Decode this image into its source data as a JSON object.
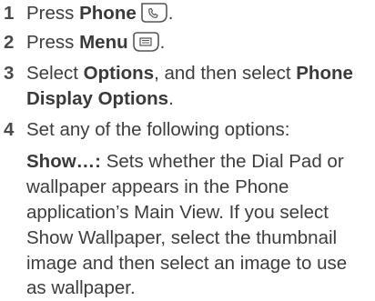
{
  "steps": [
    {
      "number": "1",
      "pre": "Press ",
      "bold": "Phone",
      "icon": "phone-button-icon",
      "post": "."
    },
    {
      "number": "2",
      "pre": "Press ",
      "bold": "Menu",
      "icon": "menu-button-icon",
      "post": "."
    },
    {
      "number": "3",
      "pre": "Select ",
      "bold": "Options",
      "mid": ", and then select ",
      "bold2_line1": "Phone",
      "bold2_line2": "Display Options",
      "post": "."
    },
    {
      "number": "4",
      "text": "Set any of the following options:"
    }
  ],
  "option": {
    "term": "Show…:",
    "desc_line1": " Sets whether the Dial Pad or",
    "lines": [
      "wallpaper appears in the Phone",
      "application’s Main View. If you select",
      "Show Wallpaper, select the thumbnail",
      "image and then select an image to use",
      "as wallpaper."
    ]
  }
}
